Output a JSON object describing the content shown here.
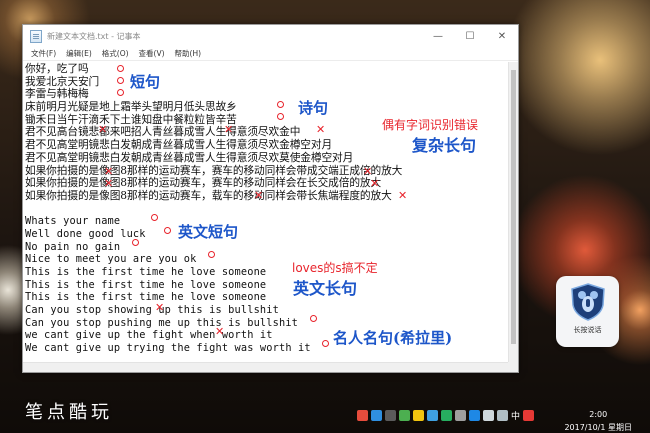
{
  "window": {
    "title": "新建文本文档.txt - 记事本",
    "controls": {
      "minimize": "—",
      "maximize": "☐",
      "close": "✕"
    },
    "menu": [
      "文件(F)",
      "编辑(E)",
      "格式(O)",
      "查看(V)",
      "帮助(H)"
    ]
  },
  "editor": {
    "lines": [
      "你好，吃了吗",
      "我爱北京天安门",
      "李雷与韩梅梅",
      "床前明月光疑是地上霜举头望明月低头思故乡",
      "锄禾日当午汗滴禾下土谁知盘中餐粒粒皆辛苦",
      "君不见高台镜悲都来吧招人青丝暮成雪人生得意须尽欢金中",
      "君不见高堂明镜悲白发朝成青丝暮成雪人生得意须尽欢金樽空对月",
      "君不见高堂明镜悲白发朝成青丝暮成雪人生得意须尽欢莫使金樽空对月",
      "如果你拍摄的是像图8那样的运动赛车，赛车的移动同样会带成交端正成倍的放大",
      "如果你拍摄的是像图8那样的运动赛车，赛车的移动同样会在长交成倍的放大",
      "如果你拍摄的是像图8那样的运动赛车，载车的移动同样会带长焦端程度的放大",
      "",
      "Whats your name",
      "Well done good luck",
      "No pain no gain",
      "Nice to meet you are you ok",
      "This is the first time he love someone",
      "This is the first time he love someone",
      "This is the first time he love someone",
      "Can you stop showing up this is bullshit",
      "Can you stop pushing me up this is bullshit",
      "we cant give up the fight when worth it",
      "We cant give up trying the fight was worth it"
    ]
  },
  "annotations": {
    "short_sentence": "短句",
    "poem": "诗句",
    "complex_long": "复杂长句",
    "recognition_note": "偶有字词识别错误",
    "english_short": "英文短句",
    "loves_note": "loves的s搞不定",
    "english_long": "英文长句",
    "famous_quotes": "名人名句(希拉里)"
  },
  "desktop": {
    "app_label": "长按说话",
    "watermark": "笔点酷玩"
  },
  "taskbar": {
    "ime": "中",
    "time": "2:00",
    "date": "2017/10/1 星期日"
  },
  "colors": {
    "annotation_blue": "#1d56c9",
    "annotation_red": "#e8242c"
  }
}
